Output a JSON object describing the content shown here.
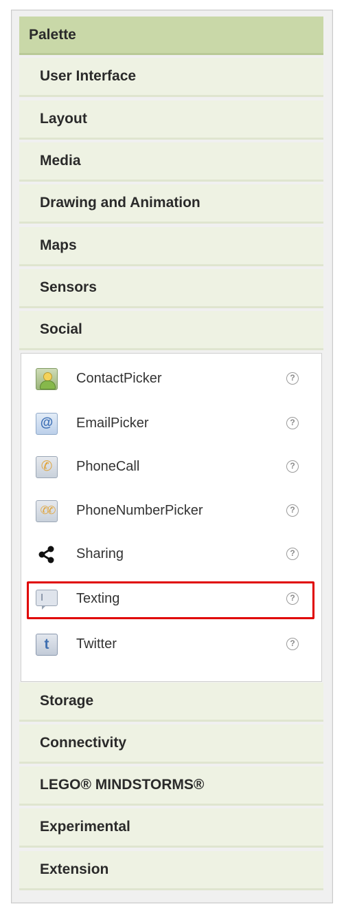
{
  "palette": {
    "header": "Palette",
    "categories_top": [
      {
        "label": "User Interface"
      },
      {
        "label": "Layout"
      },
      {
        "label": "Media"
      },
      {
        "label": "Drawing and Animation"
      },
      {
        "label": "Maps"
      },
      {
        "label": "Sensors"
      },
      {
        "label": "Social"
      }
    ],
    "social_components": [
      {
        "label": "ContactPicker",
        "icon": "contact-picker-icon",
        "help": "?"
      },
      {
        "label": "EmailPicker",
        "icon": "email-picker-icon",
        "help": "?"
      },
      {
        "label": "PhoneCall",
        "icon": "phone-call-icon",
        "help": "?"
      },
      {
        "label": "PhoneNumberPicker",
        "icon": "phone-number-picker-icon",
        "help": "?"
      },
      {
        "label": "Sharing",
        "icon": "share-icon",
        "help": "?"
      },
      {
        "label": "Texting",
        "icon": "texting-icon",
        "help": "?"
      },
      {
        "label": "Twitter",
        "icon": "twitter-icon",
        "help": "?"
      }
    ],
    "categories_bottom": [
      {
        "label": "Storage"
      },
      {
        "label": "Connectivity"
      },
      {
        "label": "LEGO® MINDSTORMS®"
      },
      {
        "label": "Experimental"
      },
      {
        "label": "Extension"
      }
    ]
  },
  "highlight": {
    "target": "Texting",
    "color": "#e00000"
  },
  "colors": {
    "header_bg": "#c9d8a8",
    "category_bg": "#eef2e3",
    "panel_bg": "#ffffff"
  }
}
